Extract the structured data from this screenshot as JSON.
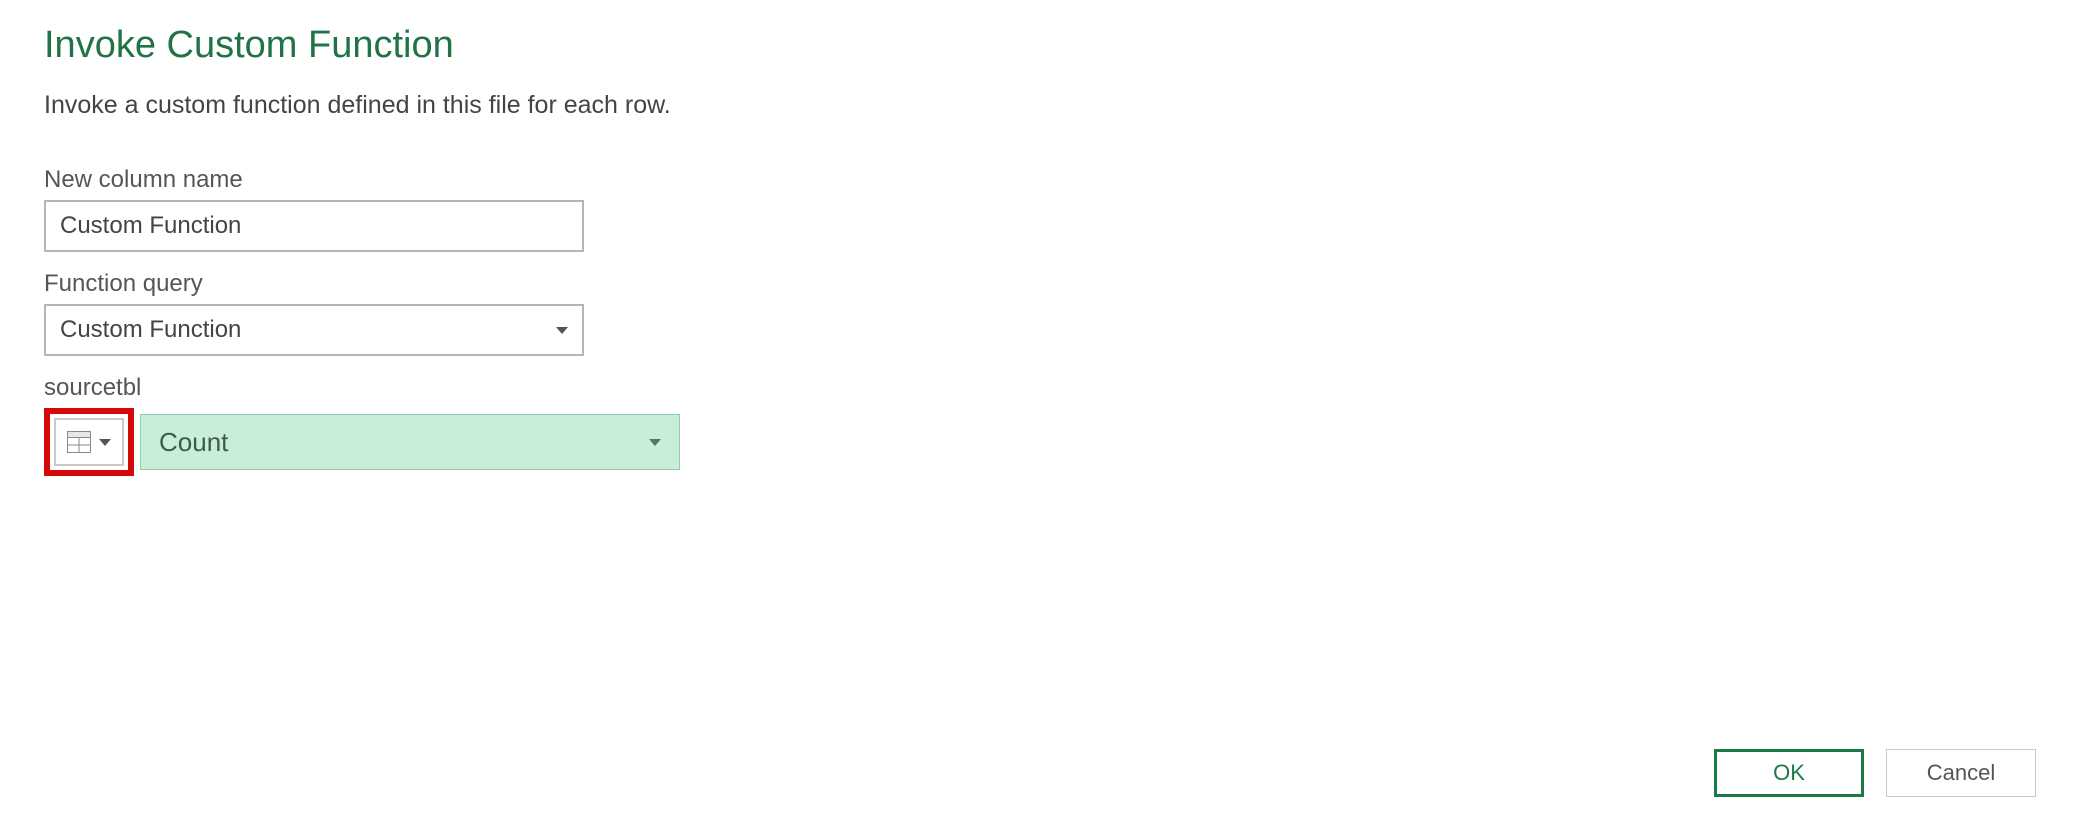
{
  "dialog": {
    "title": "Invoke Custom Function",
    "description": "Invoke a custom function defined in this file for each row."
  },
  "fields": {
    "newColumn": {
      "label": "New column name",
      "value": "Custom Function"
    },
    "functionQuery": {
      "label": "Function query",
      "value": "Custom Function"
    },
    "sourcetbl": {
      "label": "sourcetbl",
      "value": "Count"
    }
  },
  "buttons": {
    "ok": "OK",
    "cancel": "Cancel"
  }
}
